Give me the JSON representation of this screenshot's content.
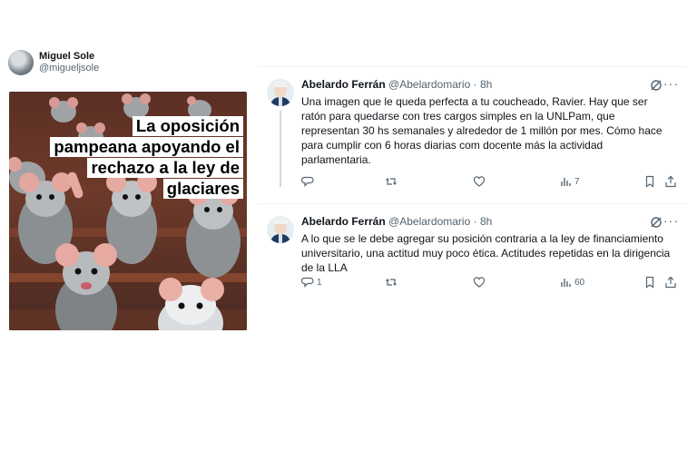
{
  "left_post": {
    "author_name": "Miguel Sole",
    "author_handle": "@migueljsole",
    "meme_caption": [
      "La oposición",
      "pampeana apoyando el",
      "rechazo a la ley de",
      "glaciares"
    ]
  },
  "tweets": [
    {
      "author_name": "Abelardo Ferrán",
      "author_handle": "@Abelardomario",
      "time": "· 8h",
      "text": "Una imagen que le queda perfecta a tu coucheado, Ravier. Hay que ser ratón para quedarse con tres cargos simples en la UNLPam, que representan 30 hs semanales y alrededor de 1 millón por mes. Cómo hace para cumplir con 6 horas diarias com docente más la actividad parlamentaria.",
      "replies": "",
      "views": "7"
    },
    {
      "author_name": "Abelardo Ferrán",
      "author_handle": "@Abelardomario",
      "time": "· 8h",
      "text": "A lo que se le debe agregar su posición contraria a la ley de financiamiento universitario, una actitud muy poco ética. Actitudes repetidas en la dirigencia de la LLA",
      "replies": "1",
      "views": "60"
    }
  ],
  "icons": {
    "reply": "reply-icon",
    "retweet": "retweet-icon",
    "like": "like-icon",
    "views": "views-icon",
    "bookmark": "bookmark-icon",
    "share": "share-icon",
    "grok": "grok-icon",
    "more": "more-icon"
  },
  "colors": {
    "icon_gray": "#536471",
    "thread_line": "#cfd9de"
  }
}
